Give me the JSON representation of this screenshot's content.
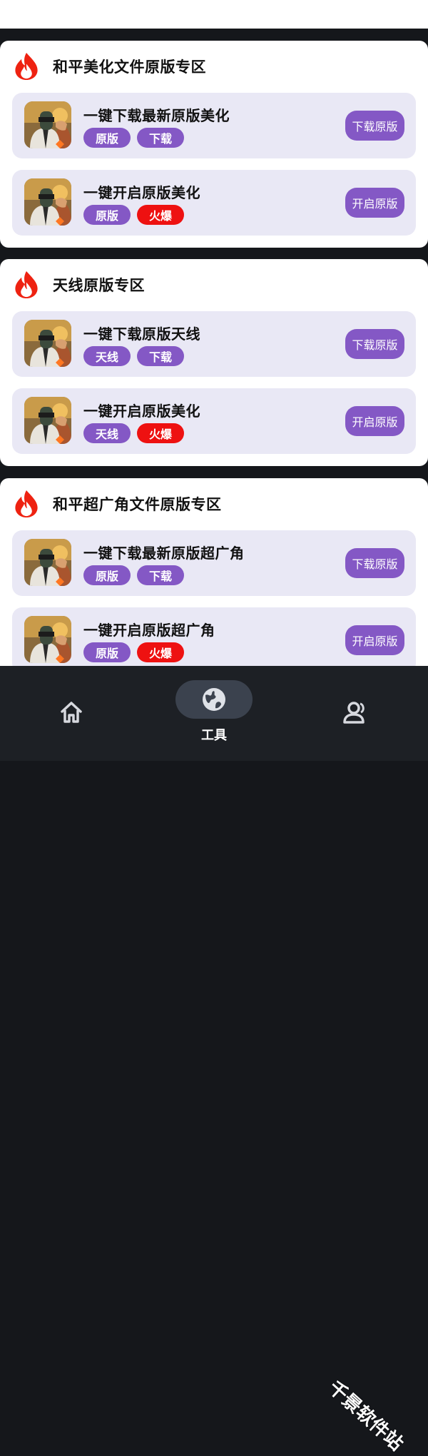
{
  "colors": {
    "accent_purple": "#8458c5",
    "hot_red": "#ee1111",
    "card_bg": "#e9e8f5",
    "nav_bg": "#1d2025",
    "page_bg": "#15171b"
  },
  "sections": [
    {
      "title": "和平美化文件原版专区",
      "icon": "fire-icon",
      "items": [
        {
          "title": "一键下载最新原版美化",
          "tags": [
            "原版",
            "下载"
          ],
          "button": "下载原版"
        },
        {
          "title": "一键开启原版美化",
          "tags": [
            "原版",
            "火爆"
          ],
          "button": "开启原版"
        }
      ]
    },
    {
      "title": "天线原版专区",
      "icon": "fire-icon",
      "items": [
        {
          "title": "一键下载原版天线",
          "tags": [
            "天线",
            "下载"
          ],
          "button": "下载原版"
        },
        {
          "title": "一键开启原版美化",
          "tags": [
            "天线",
            "火爆"
          ],
          "button": "开启原版"
        }
      ]
    },
    {
      "title": "和平超广角文件原版专区",
      "icon": "fire-icon",
      "items": [
        {
          "title": "一键下载最新原版超广角",
          "tags": [
            "原版",
            "下载"
          ],
          "button": "下载原版"
        },
        {
          "title": "一键开启原版超广角",
          "tags": [
            "原版",
            "火爆"
          ],
          "button": "开启原版"
        }
      ]
    }
  ],
  "nav": {
    "tools_label": "工具",
    "items": [
      "home-icon",
      "globe-icon",
      "user-icon"
    ]
  },
  "watermark": "千景软件站"
}
